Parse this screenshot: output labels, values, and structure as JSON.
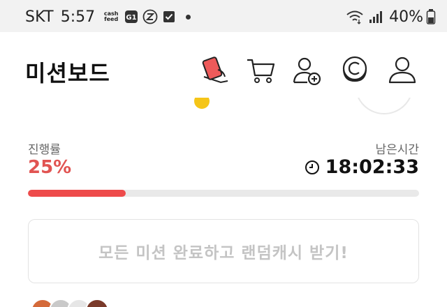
{
  "status_bar": {
    "carrier": "SKT",
    "time": "5:57",
    "cashfeed_top": "cash",
    "cashfeed_bottom": "feed",
    "battery": "40%",
    "icons": [
      "cashfeed-icon",
      "g1-app-icon",
      "z-app-icon",
      "check-box-icon",
      "notification-dot-icon",
      "wifi-icon",
      "signal-icon",
      "battery-icon"
    ]
  },
  "header": {
    "title": "미션보드",
    "icons": [
      "mission-card-icon",
      "cart-icon",
      "add-friend-icon",
      "coin-c-icon",
      "profile-icon"
    ],
    "accent_color": "#ee4b4b"
  },
  "progress": {
    "label": "진행률",
    "value_text": "25%",
    "fraction": 0.25,
    "remaining_label": "남은시간",
    "remaining_time": "18:02:33"
  },
  "cta": {
    "label": "모든 미션 완료하고 랜덤캐시 받기!"
  },
  "colors": {
    "progress_fill": "#ee4b4b",
    "progress_text": "#e15452",
    "cta_text": "#c4c4c4",
    "track": "#e9e9e9"
  }
}
